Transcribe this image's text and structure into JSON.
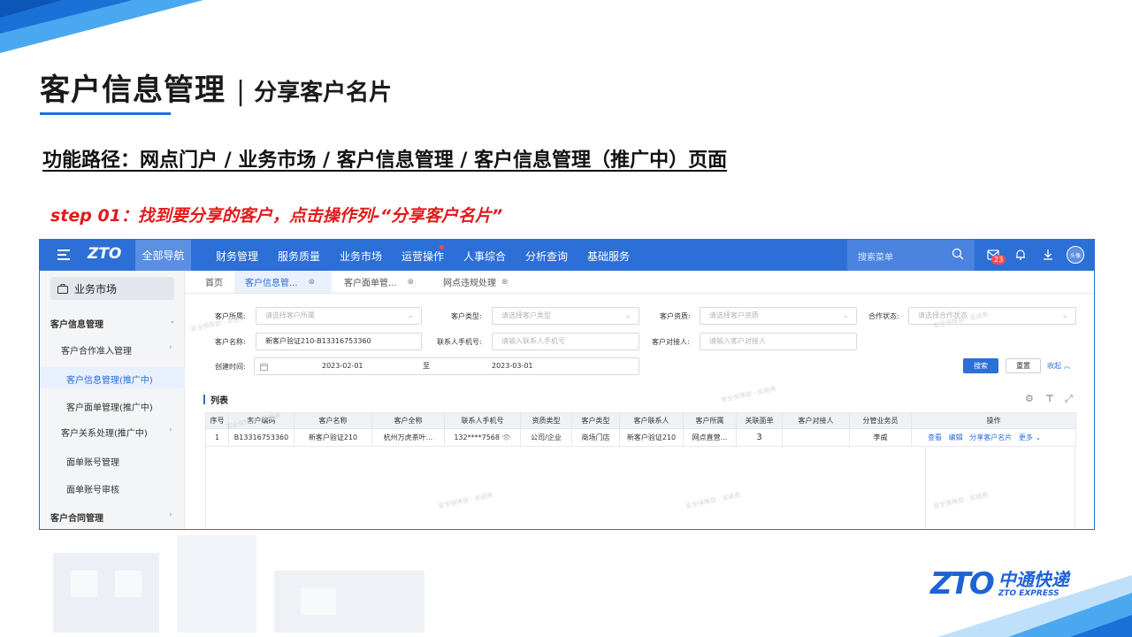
{
  "slide": {
    "title_main": "客户信息管理",
    "title_sep": "|",
    "title_sub": "分享客户名片",
    "path": "功能路径：网点门户 / 业务市场 / 客户信息管理 / 客户信息管理（推广中）页面",
    "step": "step 01：找到要分享的客户，点击操作列-“分享客户名片”",
    "logo_mark": "ZTO",
    "logo_cn": "中通快递",
    "logo_en": "ZTO EXPRESS"
  },
  "app": {
    "brand": "ZTO",
    "all_nav": "全部导航",
    "nav": [
      "财务管理",
      "服务质量",
      "业务市场",
      "运营操作",
      "人事综合",
      "分析查询",
      "基础服务"
    ],
    "search_placeholder": "搜索菜单",
    "badge_count": "23",
    "avatar_text": "头像",
    "sidebar": {
      "header": "业务市场",
      "items": [
        {
          "label": "客户信息管理",
          "arrow": "⌄"
        },
        {
          "label": "客户合作准入管理",
          "arrow": "›"
        },
        {
          "label": "客户信息管理(推广中)",
          "arrow": ""
        },
        {
          "label": "客户面单管理(推广中)",
          "arrow": ""
        },
        {
          "label": "客户关系处理(推广中)",
          "arrow": "›"
        },
        {
          "label": "面单账号管理",
          "arrow": ""
        },
        {
          "label": "面单账号审核",
          "arrow": ""
        },
        {
          "label": "客户合同管理",
          "arrow": "›"
        }
      ]
    },
    "tabs": [
      {
        "label": "首页"
      },
      {
        "label": "客户信息管..."
      },
      {
        "label": "客户面单管..."
      },
      {
        "label": "网点违规处理"
      }
    ],
    "form": {
      "owner_label": "客户所属:",
      "owner_ph": "请选择客户所属",
      "type_label": "客户类型:",
      "type_ph": "请选择客户类型",
      "qual_label": "客户资质:",
      "qual_ph": "请选择客户资质",
      "coop_label": "合作状态:",
      "coop_ph": "请选择合作状态",
      "name_label": "客户名称:",
      "name_value": "新客户验证210-B13316753360",
      "phone_label": "联系人手机号:",
      "phone_ph": "请输入联系人手机号",
      "dock_label": "客户对接人:",
      "dock_ph": "请输入客户对接人",
      "created_label": "创建时间:",
      "date_start": "2023-02-01",
      "date_to": "至",
      "date_end": "2023-03-01",
      "search_btn": "搜索",
      "reset_btn": "重置",
      "collapse_btn": "收起 ︿"
    },
    "list_title": "列表",
    "table": {
      "headers": [
        "序号",
        "客户编码",
        "客户名称",
        "客户全称",
        "联系人手机号",
        "资质类型",
        "客户类型",
        "客户联系人",
        "客户所属",
        "关联面单",
        "客户对接人",
        "分管业务员",
        "操作"
      ],
      "row": {
        "idx": "1",
        "code": "B13316753360",
        "name": "新客户验证210",
        "full": "杭州万虎茶叶...",
        "phone": "132****7568",
        "qual": "公司/企业",
        "ctype": "商场门店",
        "contact": "新客户验证210",
        "owner": "网点直营...",
        "linked": "3",
        "dock": "",
        "sales": "李威",
        "ops": [
          "查看",
          "编辑",
          "分享客户名片",
          "更多 ⌄"
        ]
      }
    },
    "watermark": "安全保障部 - 吴丽燕"
  }
}
